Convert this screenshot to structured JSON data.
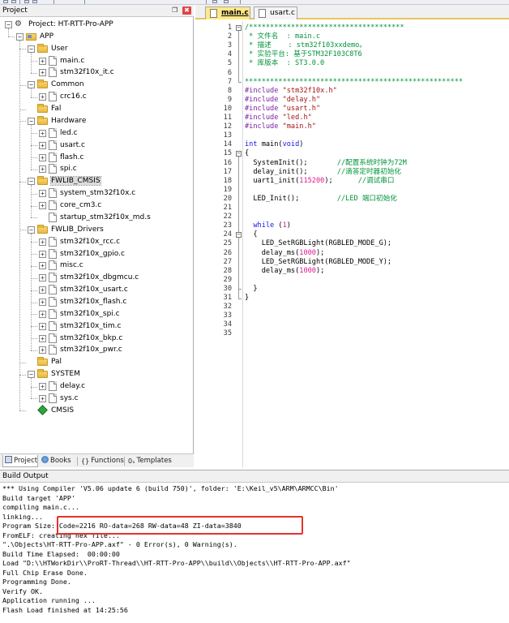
{
  "project_panel": {
    "title": "Project",
    "pin_glyph": "❒",
    "close_glyph": "✖",
    "tree": [
      {
        "label": "Project: HT-RTT-Pro-APP",
        "depth": 0,
        "kind": "project",
        "expander": "−"
      },
      {
        "label": "APP",
        "depth": 1,
        "kind": "app",
        "expander": "−"
      },
      {
        "label": "User",
        "depth": 2,
        "kind": "folder",
        "expander": "−"
      },
      {
        "label": "main.c",
        "depth": 3,
        "kind": "file",
        "expander": "+"
      },
      {
        "label": "stm32f10x_it.c",
        "depth": 3,
        "kind": "file",
        "expander": "+"
      },
      {
        "label": "Common",
        "depth": 2,
        "kind": "folder",
        "expander": "−"
      },
      {
        "label": "crc16.c",
        "depth": 3,
        "kind": "file",
        "expander": "+"
      },
      {
        "label": "Fal",
        "depth": 2,
        "kind": "folder",
        "expander": ""
      },
      {
        "label": "Hardware",
        "depth": 2,
        "kind": "folder",
        "expander": "−"
      },
      {
        "label": "led.c",
        "depth": 3,
        "kind": "file",
        "expander": "+"
      },
      {
        "label": "usart.c",
        "depth": 3,
        "kind": "file",
        "expander": "+"
      },
      {
        "label": "flash.c",
        "depth": 3,
        "kind": "file",
        "expander": "+"
      },
      {
        "label": "spi.c",
        "depth": 3,
        "kind": "file",
        "expander": "+"
      },
      {
        "label": "FWLIB_CMSIS",
        "depth": 2,
        "kind": "folder",
        "expander": "−",
        "selected": true
      },
      {
        "label": "system_stm32f10x.c",
        "depth": 3,
        "kind": "file",
        "expander": "+"
      },
      {
        "label": "core_cm3.c",
        "depth": 3,
        "kind": "file",
        "expander": "+"
      },
      {
        "label": "startup_stm32f10x_md.s",
        "depth": 3,
        "kind": "file",
        "expander": ""
      },
      {
        "label": "FWLIB_Drivers",
        "depth": 2,
        "kind": "folder",
        "expander": "−"
      },
      {
        "label": "stm32f10x_rcc.c",
        "depth": 3,
        "kind": "file",
        "expander": "+"
      },
      {
        "label": "stm32f10x_gpio.c",
        "depth": 3,
        "kind": "file",
        "expander": "+"
      },
      {
        "label": "misc.c",
        "depth": 3,
        "kind": "file",
        "expander": "+"
      },
      {
        "label": "stm32f10x_dbgmcu.c",
        "depth": 3,
        "kind": "file",
        "expander": "+"
      },
      {
        "label": "stm32f10x_usart.c",
        "depth": 3,
        "kind": "file",
        "expander": "+"
      },
      {
        "label": "stm32f10x_flash.c",
        "depth": 3,
        "kind": "file",
        "expander": "+"
      },
      {
        "label": "stm32f10x_spi.c",
        "depth": 3,
        "kind": "file",
        "expander": "+"
      },
      {
        "label": "stm32f10x_tim.c",
        "depth": 3,
        "kind": "file",
        "expander": "+"
      },
      {
        "label": "stm32f10x_bkp.c",
        "depth": 3,
        "kind": "file",
        "expander": "+"
      },
      {
        "label": "stm32f10x_pwr.c",
        "depth": 3,
        "kind": "file",
        "expander": "+"
      },
      {
        "label": "Pal",
        "depth": 2,
        "kind": "folder",
        "expander": ""
      },
      {
        "label": "SYSTEM",
        "depth": 2,
        "kind": "folder",
        "expander": "−"
      },
      {
        "label": "delay.c",
        "depth": 3,
        "kind": "file",
        "expander": "+"
      },
      {
        "label": "sys.c",
        "depth": 3,
        "kind": "file",
        "expander": "+"
      },
      {
        "label": "CMSIS",
        "depth": 2,
        "kind": "cmsis",
        "expander": ""
      }
    ],
    "tabs": [
      {
        "label": "Project",
        "icon": "project-tab-icon",
        "active": true
      },
      {
        "label": "Books",
        "icon": "books-icon",
        "active": false
      },
      {
        "label": "Functions",
        "icon": "functions-icon",
        "glyph": "{}",
        "active": false
      },
      {
        "label": "Templates",
        "icon": "templates-icon",
        "glyph": "0ₓ",
        "active": false
      }
    ]
  },
  "editor": {
    "tabs": [
      {
        "label": "main.c",
        "active": true
      },
      {
        "label": "usart.c",
        "active": false
      }
    ],
    "lines": [
      [
        [
          "/*************************************",
          "com"
        ]
      ],
      [
        [
          " * 文件名  : main.c",
          "com"
        ]
      ],
      [
        [
          " * 描述    : stm32f103xxdemo。",
          "com"
        ]
      ],
      [
        [
          " * 实验平台: 基于STM32F103C8T6",
          "com"
        ]
      ],
      [
        [
          " * 库版本  : ST3.0.0",
          "com"
        ]
      ],
      [
        [
          " ",
          "com"
        ]
      ],
      [
        [
          "****************************************************",
          "com"
        ]
      ],
      [
        [
          "#include ",
          "pp"
        ],
        [
          "\"stm32f10x.h\"",
          "str"
        ]
      ],
      [
        [
          "#include ",
          "pp"
        ],
        [
          "\"delay.h\"",
          "str"
        ]
      ],
      [
        [
          "#include ",
          "pp"
        ],
        [
          "\"usart.h\"",
          "str"
        ]
      ],
      [
        [
          "#include ",
          "pp"
        ],
        [
          "\"led.h\"",
          "str"
        ]
      ],
      [
        [
          "#include ",
          "pp"
        ],
        [
          "\"main.h\"",
          "str"
        ]
      ],
      [],
      [
        [
          "int",
          "kw"
        ],
        [
          " main(",
          "txt"
        ],
        [
          "void",
          "kw"
        ],
        [
          ")",
          "txt"
        ]
      ],
      [
        [
          "{",
          "txt"
        ]
      ],
      [
        [
          "  SystemInit();       ",
          "txt"
        ],
        [
          "//配置系统时钟为72M",
          "com"
        ]
      ],
      [
        [
          "  delay_init();       ",
          "txt"
        ],
        [
          "//滴答定时器初始化",
          "com"
        ]
      ],
      [
        [
          "  uart1_init(",
          "txt"
        ],
        [
          "115200",
          "num"
        ],
        [
          ");      ",
          "txt"
        ],
        [
          "//调试串口",
          "com"
        ]
      ],
      [],
      [
        [
          "  LED_Init();         ",
          "txt"
        ],
        [
          "//LED 端口初始化",
          "com"
        ]
      ],
      [],
      [],
      [
        [
          "  ",
          "txt"
        ],
        [
          "while",
          "kw"
        ],
        [
          " (",
          "txt"
        ],
        [
          "1",
          "num"
        ],
        [
          ")",
          "txt"
        ]
      ],
      [
        [
          "  {",
          "txt"
        ]
      ],
      [
        [
          "    LED_SetRGBLight(RGBLED_MODE_G);",
          "txt"
        ]
      ],
      [
        [
          "    delay_ms(",
          "txt"
        ],
        [
          "1000",
          "num"
        ],
        [
          ");",
          "txt"
        ]
      ],
      [
        [
          "    LED_SetRGBLight(RGBLED_MODE_Y);",
          "txt"
        ]
      ],
      [
        [
          "    delay_ms(",
          "txt"
        ],
        [
          "1000",
          "num"
        ],
        [
          ");",
          "txt"
        ]
      ],
      [],
      [
        [
          "  }",
          "txt"
        ]
      ],
      [
        [
          "}",
          "txt"
        ]
      ],
      [],
      [],
      [],
      []
    ]
  },
  "build_output": {
    "title": "Build Output",
    "lines": [
      "*** Using Compiler 'V5.06 update 6 (build 750)', folder: 'E:\\Keil_v5\\ARM\\ARMCC\\Bin'",
      "Build target 'APP'",
      "compiling main.c...",
      "linking...",
      "Program Size: Code=2216 RO-data=268 RW-data=48 ZI-data=3840",
      "FromELF: creating hex file...",
      "\".\\Objects\\HT-RTT-Pro-APP.axf\" - 0 Error(s), 0 Warning(s).",
      "Build Time Elapsed:  00:00:00",
      "Load \"D:\\\\HTWorkDir\\\\ProRT-Thread\\\\HT-RTT-Pro-APP\\\\build\\\\Objects\\\\HT-RTT-Pro-APP.axf\"",
      "Full Chip Erase Done.",
      "Programming Done.",
      "Verify OK.",
      "Application running ...",
      "Flash Load finished at 14:25:56"
    ]
  },
  "colors": {
    "comment": "#00933b",
    "keyword": "#1515e6",
    "preprocessor": "#7b1fa2",
    "string": "#a31515",
    "number": "#e01b8e",
    "active_tab": "#ffe98a",
    "highlight_box": "#e5332a"
  }
}
